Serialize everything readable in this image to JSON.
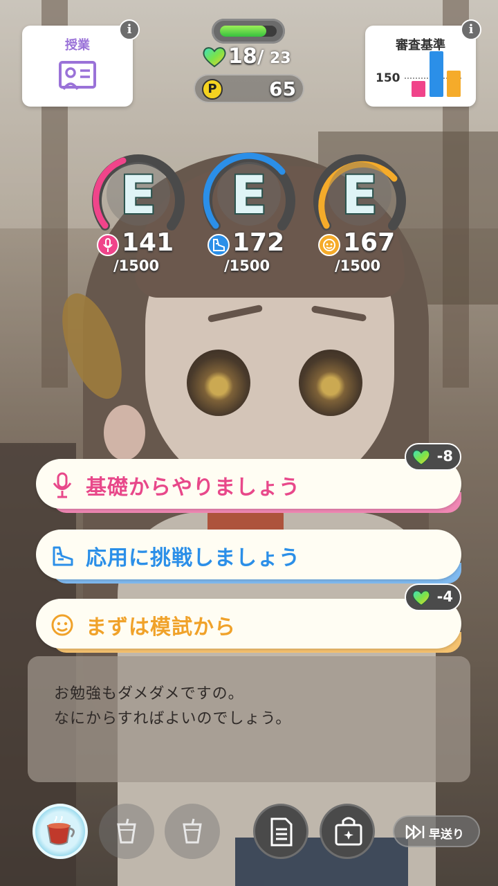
{
  "lesson_card": {
    "title": "授業",
    "icon": "lesson-board-icon"
  },
  "criteria_card": {
    "title": "審査基準",
    "threshold": "150",
    "bars": [
      {
        "color": "#f0448a",
        "level": 0.22
      },
      {
        "color": "#2b8fe8",
        "level": 0.62
      },
      {
        "color": "#f5ab2a",
        "level": 0.36
      }
    ]
  },
  "info_icon": "info-icon",
  "stamina": {
    "current": "18",
    "separator": "/",
    "max": "23",
    "fill_fraction": 0.82,
    "color": "#4fd446"
  },
  "p_points": {
    "icon_label": "P",
    "value": "65"
  },
  "stats": [
    {
      "name": "vocal",
      "rank": "E",
      "value": "141",
      "max": "/1500",
      "color": "#f0448a",
      "icon": "microphone-icon",
      "fraction": 0.094
    },
    {
      "name": "dance",
      "rank": "E",
      "value": "172",
      "max": "/1500",
      "color": "#2b8fe8",
      "icon": "dance-shoe-icon",
      "fraction": 0.115
    },
    {
      "name": "visual",
      "rank": "E",
      "value": "167",
      "max": "/1500",
      "color": "#f5ab2a",
      "icon": "visual-face-icon",
      "fraction": 0.111
    }
  ],
  "choices": [
    {
      "label": "基礎からやりましょう",
      "color": "#e8488a",
      "icon": "microphone-icon",
      "cost": "-8"
    },
    {
      "label": "応用に挑戦しましょう",
      "color": "#2b8fe8",
      "icon": "dance-shoe-icon",
      "cost": null
    },
    {
      "label": "まずは模試から",
      "color": "#f0a22a",
      "icon": "visual-face-icon",
      "cost": "-4"
    }
  ],
  "dialogue": {
    "lines": [
      "お勉強もダメダメですの。",
      "なにからすればよいのでしょう。"
    ]
  },
  "bottom_bar": {
    "skip_label": "早送り",
    "buttons": [
      "tea-cup-icon",
      "drink-icon",
      "drink-icon",
      "memo-icon",
      "bag-icon"
    ]
  }
}
